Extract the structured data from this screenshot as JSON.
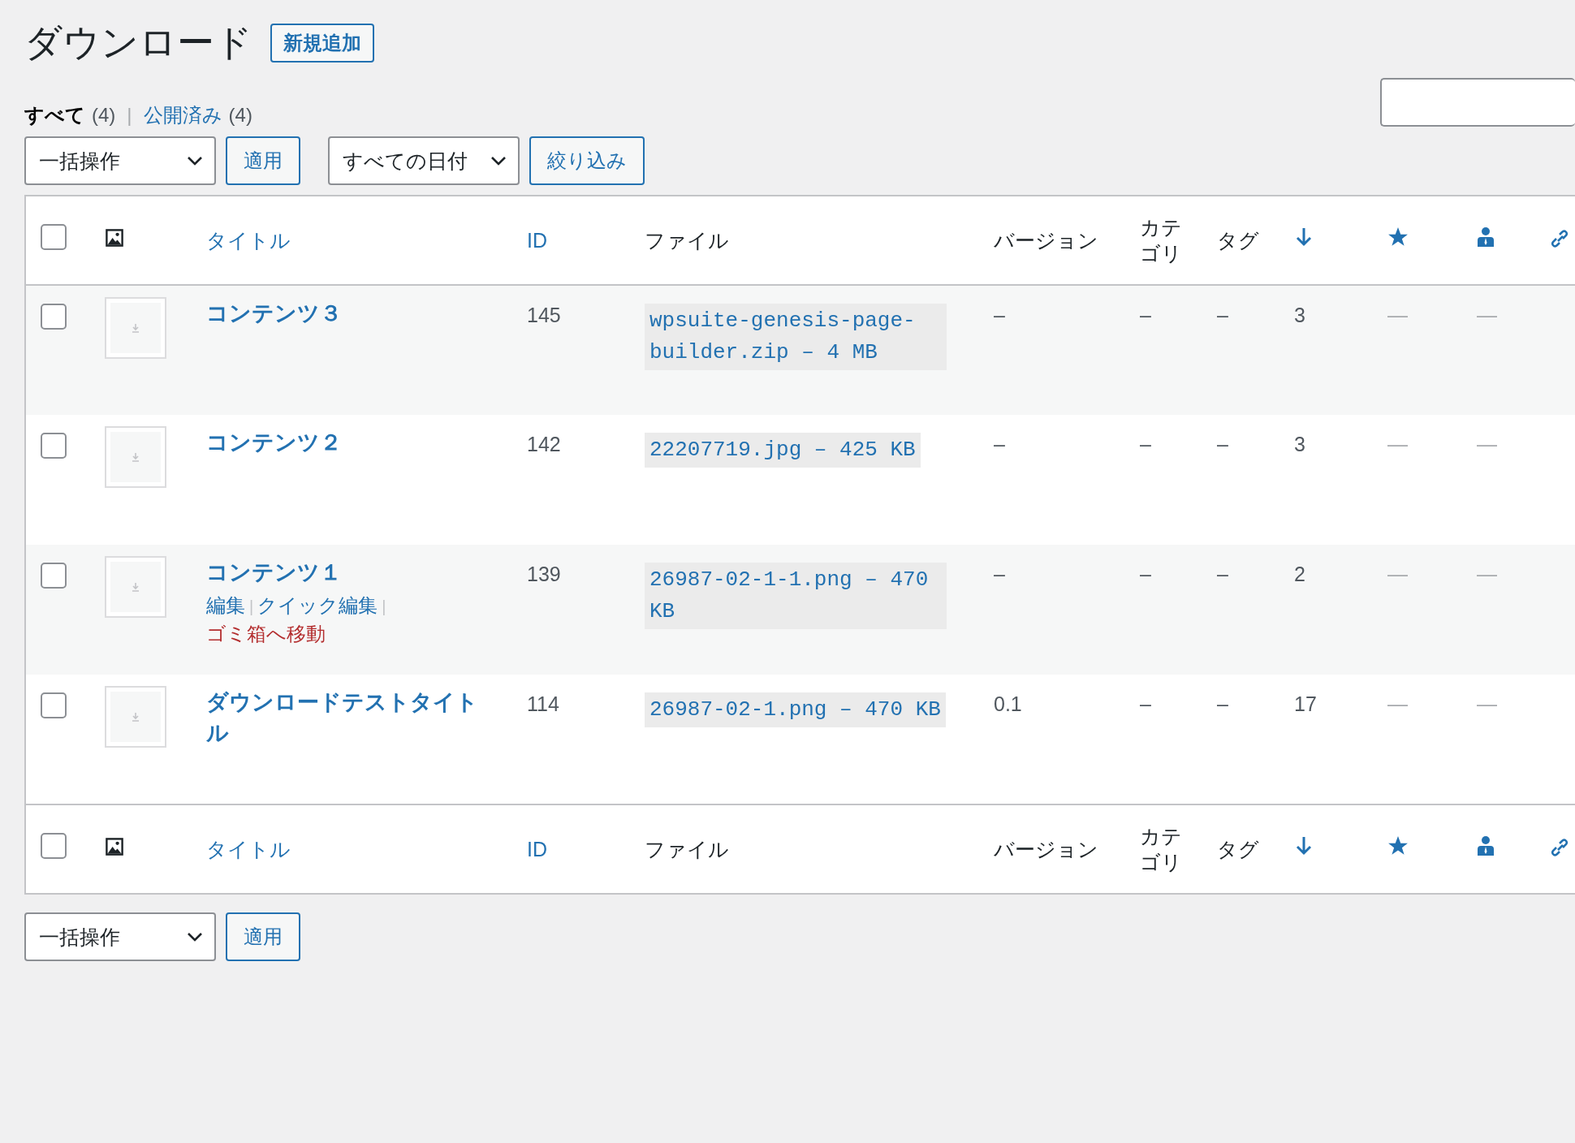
{
  "page_title": "ダウンロード",
  "add_new_button": "新規追加",
  "views": [
    {
      "label": "すべて",
      "count": "(4)",
      "selected": true
    },
    {
      "label": "公開済み",
      "count": "(4)",
      "selected": false
    }
  ],
  "view_separator": "|",
  "top_actions": {
    "bulk_select": "一括操作",
    "apply_button": "適用",
    "date_select": "すべての日付",
    "filter_button": "絞り込み"
  },
  "columns": [
    {
      "kind": "checkbox",
      "checked": false
    },
    {
      "kind": "image"
    },
    {
      "kind": "text",
      "label": "タイトル",
      "sortable": true
    },
    {
      "kind": "text",
      "label": "ID",
      "sortable": true
    },
    {
      "kind": "text",
      "label": "ファイル",
      "sortable": false
    },
    {
      "kind": "text",
      "label": "バージョン",
      "sortable": false
    },
    {
      "kind": "text",
      "label": "カテゴリ",
      "sortable": false
    },
    {
      "kind": "text",
      "label": "タグ",
      "sortable": false
    },
    {
      "kind": "download",
      "sortable": true
    },
    {
      "kind": "star",
      "sortable": true
    },
    {
      "kind": "user",
      "sortable": true
    },
    {
      "kind": "link",
      "sortable": true
    }
  ],
  "rows": [
    {
      "checked": false,
      "title": "コンテンツ３",
      "id": "145",
      "file": "wpsuite-genesis-page-builder.zip – 4 MB",
      "version": "–",
      "category": "–",
      "tag": "–",
      "downloads": "3",
      "column_10": "—",
      "column_11": "—"
    },
    {
      "checked": false,
      "title": "コンテンツ２",
      "id": "142",
      "file": "22207719.jpg – 425 KB",
      "version": "–",
      "category": "–",
      "tag": "–",
      "downloads": "3",
      "column_10": "—",
      "column_11": "—"
    },
    {
      "checked": false,
      "title": "コンテンツ１",
      "id": "139",
      "file": "26987-02-1-1.png – 470 KB",
      "version": "–",
      "category": "–",
      "tag": "–",
      "downloads": "2",
      "column_10": "—",
      "column_11": "—",
      "row_actions": [
        {
          "kind": "link",
          "label": "編集"
        },
        {
          "kind": "link",
          "label": "クイック編集"
        },
        {
          "kind": "delete",
          "label": "ゴミ箱へ移動"
        }
      ]
    },
    {
      "checked": false,
      "title": "ダウンロードテストタイトル",
      "id": "114",
      "file": "26987-02-1.png – 470 KB",
      "version": "0.1",
      "category": "–",
      "tag": "–",
      "downloads": "17",
      "column_10": "—",
      "column_11": "—"
    }
  ],
  "row_action_separator": "|",
  "footer_columns": [
    {
      "kind": "checkbox",
      "checked": false
    },
    {
      "kind": "image"
    },
    {
      "kind": "text",
      "label": "タイトル",
      "sortable": true
    },
    {
      "kind": "text",
      "label": "ID",
      "sortable": true
    },
    {
      "kind": "text",
      "label": "ファイル",
      "sortable": false
    },
    {
      "kind": "text",
      "label": "バージョン",
      "sortable": false
    },
    {
      "kind": "text",
      "label": "カテゴリ",
      "sortable": false
    },
    {
      "kind": "text",
      "label": "タグ",
      "sortable": false
    },
    {
      "kind": "download",
      "sortable": true
    },
    {
      "kind": "star",
      "sortable": true
    },
    {
      "kind": "user",
      "sortable": true
    },
    {
      "kind": "link",
      "sortable": true
    }
  ],
  "bottom_actions": {
    "bulk_select": "一括操作",
    "apply_button": "適用"
  }
}
